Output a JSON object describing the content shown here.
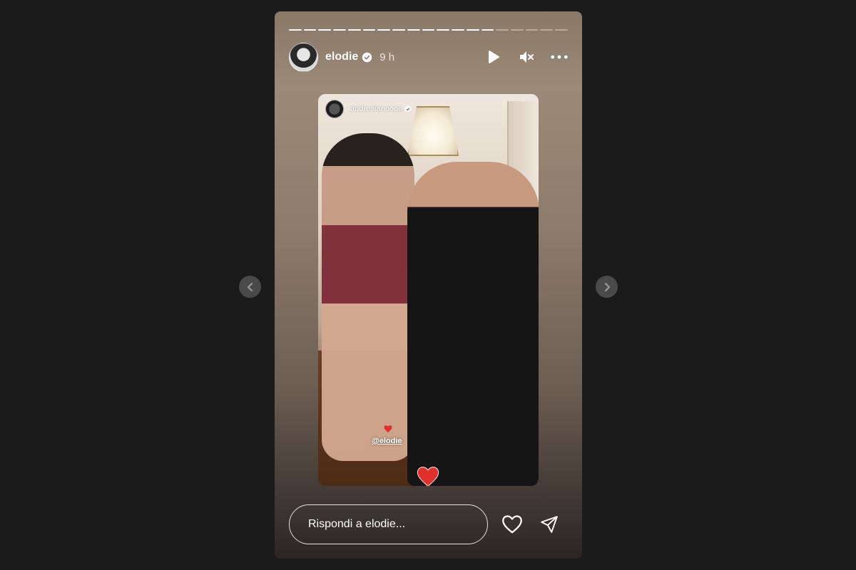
{
  "story": {
    "username": "elodie",
    "verified_icon": "verified-badge-icon",
    "time": "9 h",
    "progress": {
      "segments_total": 19,
      "segments_done": 14
    },
    "controls": {
      "play_icon": "play-icon",
      "mute_icon": "muted-speaker-icon",
      "more_icon": "more-options-icon"
    },
    "repost": {
      "username": "andreaiannone"
    },
    "sticker": {
      "mention": "@elodie",
      "heart_icon": "red-heart-icon"
    },
    "reply": {
      "placeholder": "Rispondi a elodie..."
    },
    "actions": {
      "like_icon": "heart-outline-icon",
      "share_icon": "send-icon"
    }
  },
  "navigation": {
    "prev_icon": "chevron-left-icon",
    "next_icon": "chevron-right-icon"
  },
  "colors": {
    "background": "#1b1b1b",
    "heart": "#e0302c",
    "nav_button": "#4a4a4a"
  }
}
